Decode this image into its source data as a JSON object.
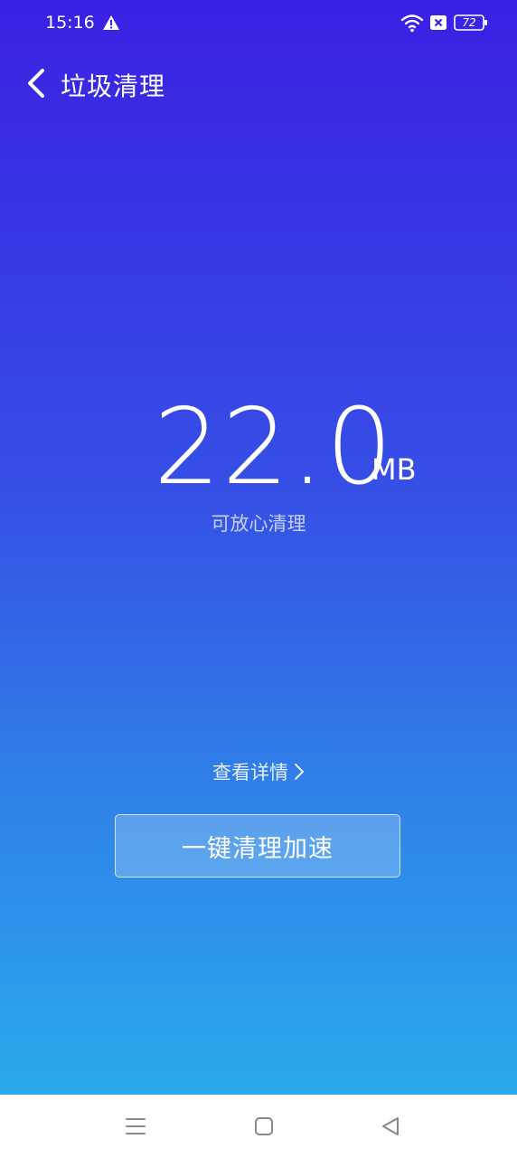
{
  "status_bar": {
    "time": "15:16",
    "battery_level": "72",
    "icons": [
      "warning-icon",
      "wifi-icon",
      "sim-icon",
      "battery-icon"
    ]
  },
  "header": {
    "title": "垃圾清理",
    "back_icon": "chevron-left-icon"
  },
  "junk": {
    "size_value": "22.0",
    "size_unit": "MB",
    "hint": "可放心清理"
  },
  "actions": {
    "details_label": "查看详情",
    "clean_button_label": "一键清理加速"
  },
  "nav_bar": {
    "icons": [
      "menu-icon",
      "home-icon",
      "back-icon"
    ]
  },
  "colors": {
    "gradient_top": "#3a21e4",
    "gradient_bottom": "#2aa9ec",
    "nav_bg": "#ffffff"
  }
}
